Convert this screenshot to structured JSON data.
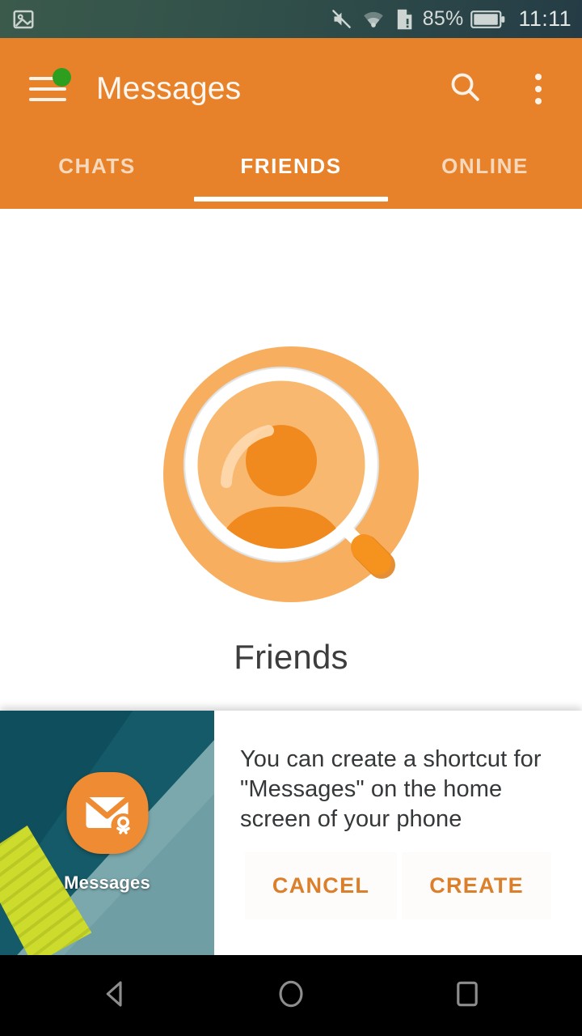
{
  "statusbar": {
    "notification_icon": "screenshot-image-icon",
    "mute_icon": "volume-mute-icon",
    "wifi_icon": "wifi-icon",
    "sim_icon": "sim-card-alert-icon",
    "battery_percent": "85%",
    "battery_icon": "battery-icon",
    "clock": "11:11",
    "background_color": "#32514a"
  },
  "appbar": {
    "menu_icon": "hamburger-menu-icon",
    "menu_badge_color": "#2E9E1E",
    "title": "Messages",
    "search_icon": "search-icon",
    "overflow_icon": "more-vert-icon",
    "background_color": "#E8822A",
    "tabs": [
      {
        "label": "CHATS",
        "active": false
      },
      {
        "label": "FRIENDS",
        "active": true
      },
      {
        "label": "ONLINE",
        "active": false
      }
    ]
  },
  "content": {
    "illustration_icon": "search-person-magnifier-icon",
    "empty_title": "Friends",
    "illustration_colors": {
      "outer_circle": "#F7AE5E",
      "lens_fill": "#F7AE5E",
      "lens_ring": "#FFFFFF",
      "person": "#F08A1E",
      "handle": "#F08A1E"
    }
  },
  "dialog": {
    "preview": {
      "app_icon": "messages-ok-envelope-icon",
      "app_icon_color": "#EE8B33",
      "app_label": "Messages",
      "wallpaper_colors": [
        "#155a68",
        "#0f4e5c",
        "#7aa8ad",
        "#cddb2c"
      ]
    },
    "message": "You can create a shortcut for \"Messages\" on the home screen of your phone",
    "cancel_label": "CANCEL",
    "create_label": "CREATE",
    "button_text_color": "#DB7F2B"
  },
  "navbar": {
    "back_icon": "back-triangle-icon",
    "home_icon": "home-circle-icon",
    "recents_icon": "recents-square-icon",
    "background_color": "#000000"
  }
}
